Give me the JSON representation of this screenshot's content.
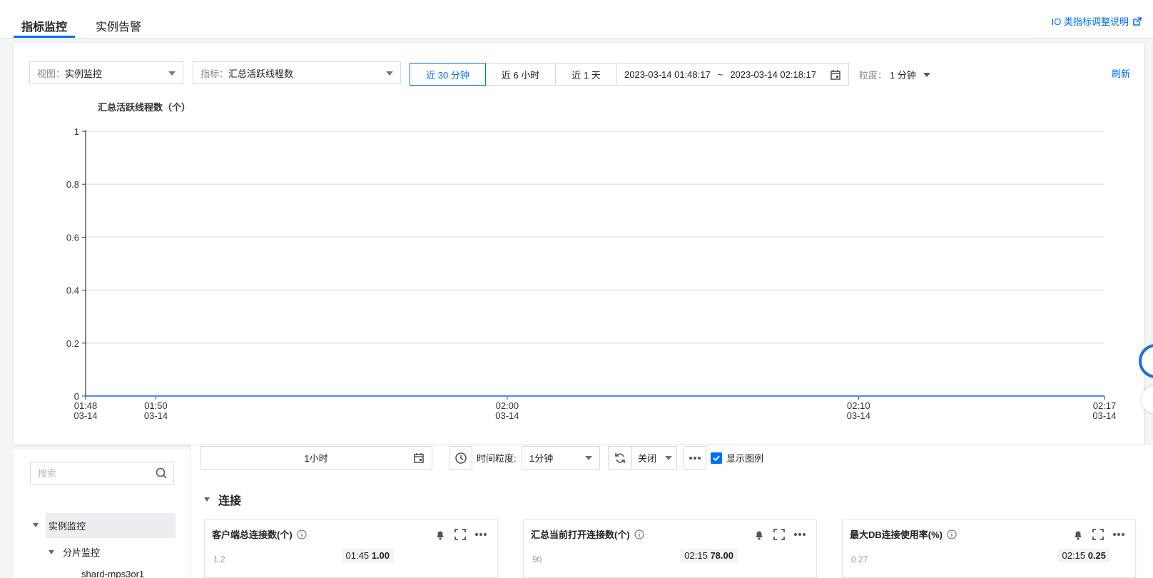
{
  "tabs": [
    {
      "label": "指标监控",
      "active": true
    },
    {
      "label": "实例告警",
      "active": false
    }
  ],
  "io_link": "IO 类指标调整说明",
  "toolbar": {
    "view_label": "视图：",
    "view_value": "实例监控",
    "metric_label": "指标：",
    "metric_value": "汇总活跃线程数",
    "ranges": [
      "近 30 分钟",
      "近 6 小时",
      "近 1 天"
    ],
    "active_range": 0,
    "start": "2023-03-14 01:48:17",
    "separator": "~",
    "end": "2023-03-14 02:18:17",
    "granularity_label": "粒度：",
    "granularity_value": "1 分钟",
    "refresh": "刷新"
  },
  "chart_data": {
    "type": "line",
    "title": "汇总活跃线程数（个）",
    "ylim": [
      0,
      1
    ],
    "y_ticks": [
      "0",
      "0.2",
      "0.4",
      "0.6",
      "0.8",
      "1"
    ],
    "x_ticks": [
      {
        "time": "01:48",
        "date": "03-14",
        "minute": 0
      },
      {
        "time": "01:50",
        "date": "03-14",
        "minute": 2
      },
      {
        "time": "02:00",
        "date": "03-14",
        "minute": 12
      },
      {
        "time": "02:10",
        "date": "03-14",
        "minute": 22
      },
      {
        "time": "02:17",
        "date": "03-14",
        "minute": 29
      }
    ],
    "xlim": [
      0,
      29
    ],
    "series": [
      {
        "values": [
          0,
          0
        ]
      }
    ],
    "grid": true,
    "colors": {
      "line": "#4e8ef7",
      "grid": "#e5e5e5",
      "axis": "#333333"
    }
  },
  "bottom": {
    "search_placeholder": "搜索",
    "tree": [
      {
        "label": "实例监控",
        "level": 0,
        "selected": true
      },
      {
        "label": "分片监控",
        "level": 1,
        "selected": false
      },
      {
        "label": "shard-rnps3or1",
        "level": 2,
        "selected": false
      }
    ],
    "range_value": "1小时",
    "time_gran_label": "时间粒度:",
    "time_gran_value": "1分钟",
    "auto_refresh_value": "关闭",
    "show_legend_label": "显示图例",
    "section_title": "连接",
    "cards": [
      {
        "title": "客户端总连接数(个)",
        "ytick": "1.2",
        "tip_time": "01:45",
        "tip_value": "1.00"
      },
      {
        "title": "汇总当前打开连接数(个)",
        "ytick": "90",
        "tip_time": "02:15",
        "tip_value": "78.00"
      },
      {
        "title": "最大DB连接使用率(%)",
        "ytick": "0.27",
        "tip_time": "02:15",
        "tip_value": "0.25"
      }
    ]
  }
}
